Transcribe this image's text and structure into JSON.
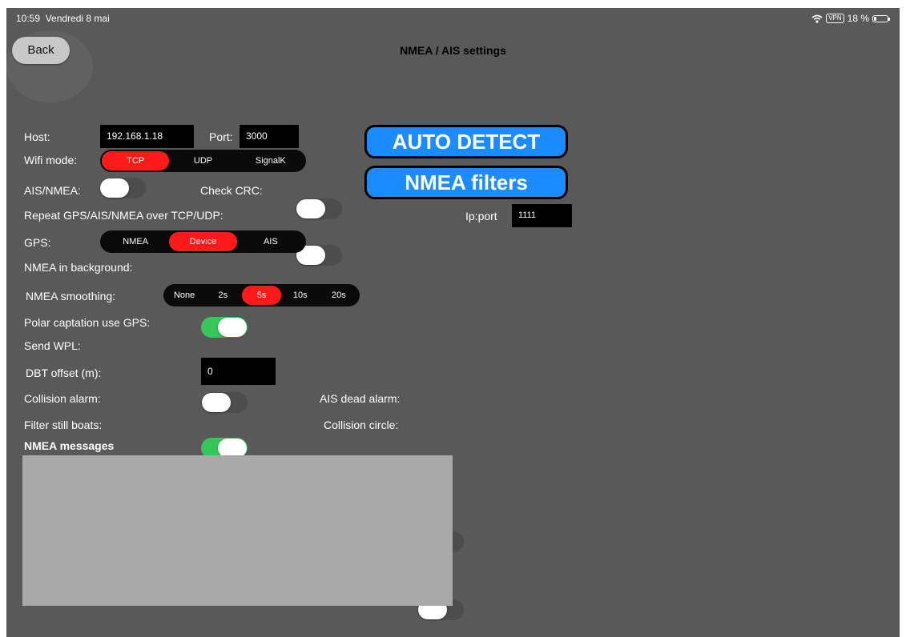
{
  "status_bar": {
    "time": "10:59",
    "date": "Vendredi 8 mai",
    "vpn": "VPN",
    "battery": "18 %",
    "battery_level": 0.18
  },
  "nav": {
    "back_label": "Back",
    "title": "NMEA / AIS settings"
  },
  "connection": {
    "host_label": "Host:",
    "host_value": "192.168.1.18",
    "port_label": "Port:",
    "port_value": "3000"
  },
  "wifi_mode": {
    "label": "Wifi mode:",
    "options": [
      "TCP",
      "UDP",
      "SignalK"
    ],
    "selected": "TCP"
  },
  "ais_nmea": {
    "label": "AIS/NMEA:",
    "on": false
  },
  "check_crc": {
    "label": "Check CRC:",
    "on": false
  },
  "repeat": {
    "label": "Repeat GPS/AIS/NMEA over TCP/UDP:",
    "on": false
  },
  "ip_port": {
    "label": "Ip:port",
    "value": "1111"
  },
  "buttons": {
    "auto_detect": "AUTO DETECT",
    "nmea_filters": "NMEA filters"
  },
  "gps": {
    "label": "GPS:",
    "options": [
      "NMEA",
      "Device",
      "AIS"
    ],
    "selected": "Device"
  },
  "nmea_background": {
    "label": "NMEA in background:",
    "on": true
  },
  "smoothing": {
    "label": "NMEA smoothing:",
    "options": [
      "None",
      "2s",
      "5s",
      "10s",
      "20s"
    ],
    "selected": "5s"
  },
  "polar_captation": {
    "label": "Polar captation use GPS:",
    "on": false
  },
  "send_wpl": {
    "label": "Send WPL:",
    "on": true
  },
  "dbt_offset": {
    "label": "DBT offset (m):",
    "value": "0"
  },
  "collision_alarm": {
    "label": "Collision alarm:",
    "on": false
  },
  "ais_dead_alarm": {
    "label": "AIS dead alarm:",
    "on": false
  },
  "filter_still_boats": {
    "label": "Filter still boats:",
    "on": true
  },
  "collision_circle": {
    "label": "Collision circle:",
    "on": false
  },
  "messages": {
    "title": "NMEA messages"
  },
  "colors": {
    "background": "#595959",
    "accent_blue": "#1a8cff",
    "selected_red": "#ff1a1a",
    "switch_on": "#34c759",
    "field_bg": "#000000"
  }
}
